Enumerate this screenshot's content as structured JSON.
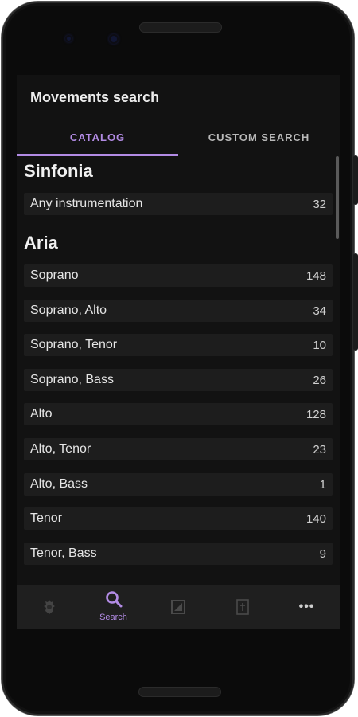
{
  "app": {
    "title": "Movements search"
  },
  "tabs": [
    {
      "label": "CATALOG",
      "selected": true
    },
    {
      "label": "CUSTOM SEARCH",
      "selected": false
    }
  ],
  "sections": [
    {
      "title": "Sinfonia",
      "rows": [
        {
          "label": "Any instrumentation",
          "count": "32"
        }
      ]
    },
    {
      "title": "Aria",
      "rows": [
        {
          "label": "Soprano",
          "count": "148"
        },
        {
          "label": "Soprano, Alto",
          "count": "34"
        },
        {
          "label": "Soprano, Tenor",
          "count": "10"
        },
        {
          "label": "Soprano, Bass",
          "count": "26"
        },
        {
          "label": "Alto",
          "count": "128"
        },
        {
          "label": "Alto, Tenor",
          "count": "23"
        },
        {
          "label": "Alto, Bass",
          "count": "1"
        },
        {
          "label": "Tenor",
          "count": "140"
        },
        {
          "label": "Tenor, Bass",
          "count": "9"
        }
      ]
    }
  ],
  "bottom_nav": [
    {
      "icon": "crest-icon",
      "label": ""
    },
    {
      "icon": "search-icon",
      "label": "Search",
      "active": true
    },
    {
      "icon": "score-icon",
      "label": ""
    },
    {
      "icon": "cross-icon",
      "label": ""
    },
    {
      "icon": "more-icon",
      "label": ""
    }
  ],
  "colors": {
    "accent": "#b28be4",
    "background": "#121212",
    "row": "#1d1d1d",
    "nav": "#1f1f1f"
  }
}
